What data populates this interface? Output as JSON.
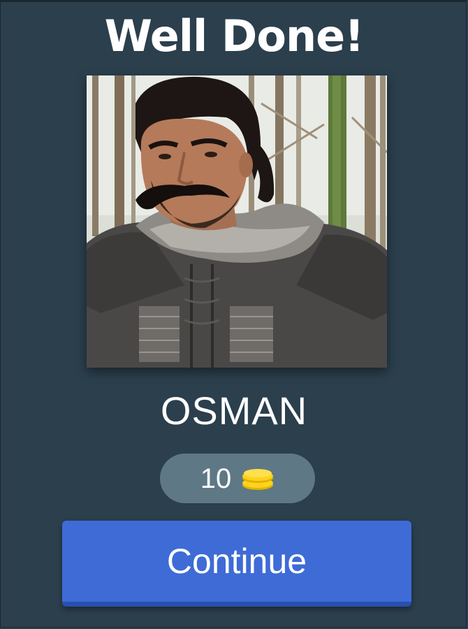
{
  "result": {
    "title": "Well Done!",
    "answer": "OSMAN"
  },
  "reward": {
    "amount": "10",
    "icon": "coin-stack-icon",
    "coin_color": "#ffd21f"
  },
  "actions": {
    "continue_label": "Continue"
  },
  "colors": {
    "background": "#2b3f4d",
    "pill": "#5f7886",
    "button": "#3e6bd6"
  }
}
